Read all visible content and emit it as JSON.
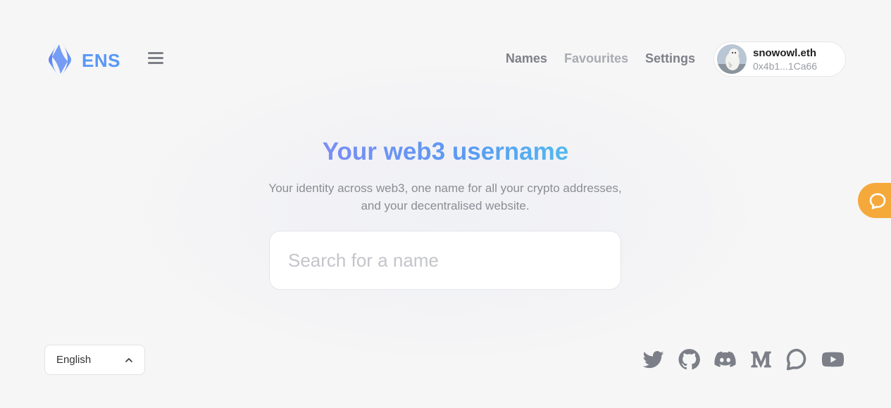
{
  "header": {
    "logo_text": "ENS",
    "nav": [
      {
        "label": "Names"
      },
      {
        "label": "Favourites"
      },
      {
        "label": "Settings"
      }
    ],
    "profile": {
      "name": "snowowl.eth",
      "address": "0x4b1...1Ca66"
    }
  },
  "hero": {
    "title": "Your web3 username",
    "subtitle_line1": "Your identity across web3, one name for all your crypto addresses,",
    "subtitle_line2": "and your decentralised website.",
    "search_placeholder": "Search for a name"
  },
  "footer": {
    "language": "English",
    "social_icons": [
      "twitter-icon",
      "github-icon",
      "discord-icon",
      "medium-icon",
      "discourse-icon",
      "youtube-icon"
    ]
  },
  "colors": {
    "brand_blue": "#5898f5",
    "chat_orange": "#f6a93b",
    "nav_text": "#7e8089",
    "icon_gray": "#7c7f88"
  }
}
